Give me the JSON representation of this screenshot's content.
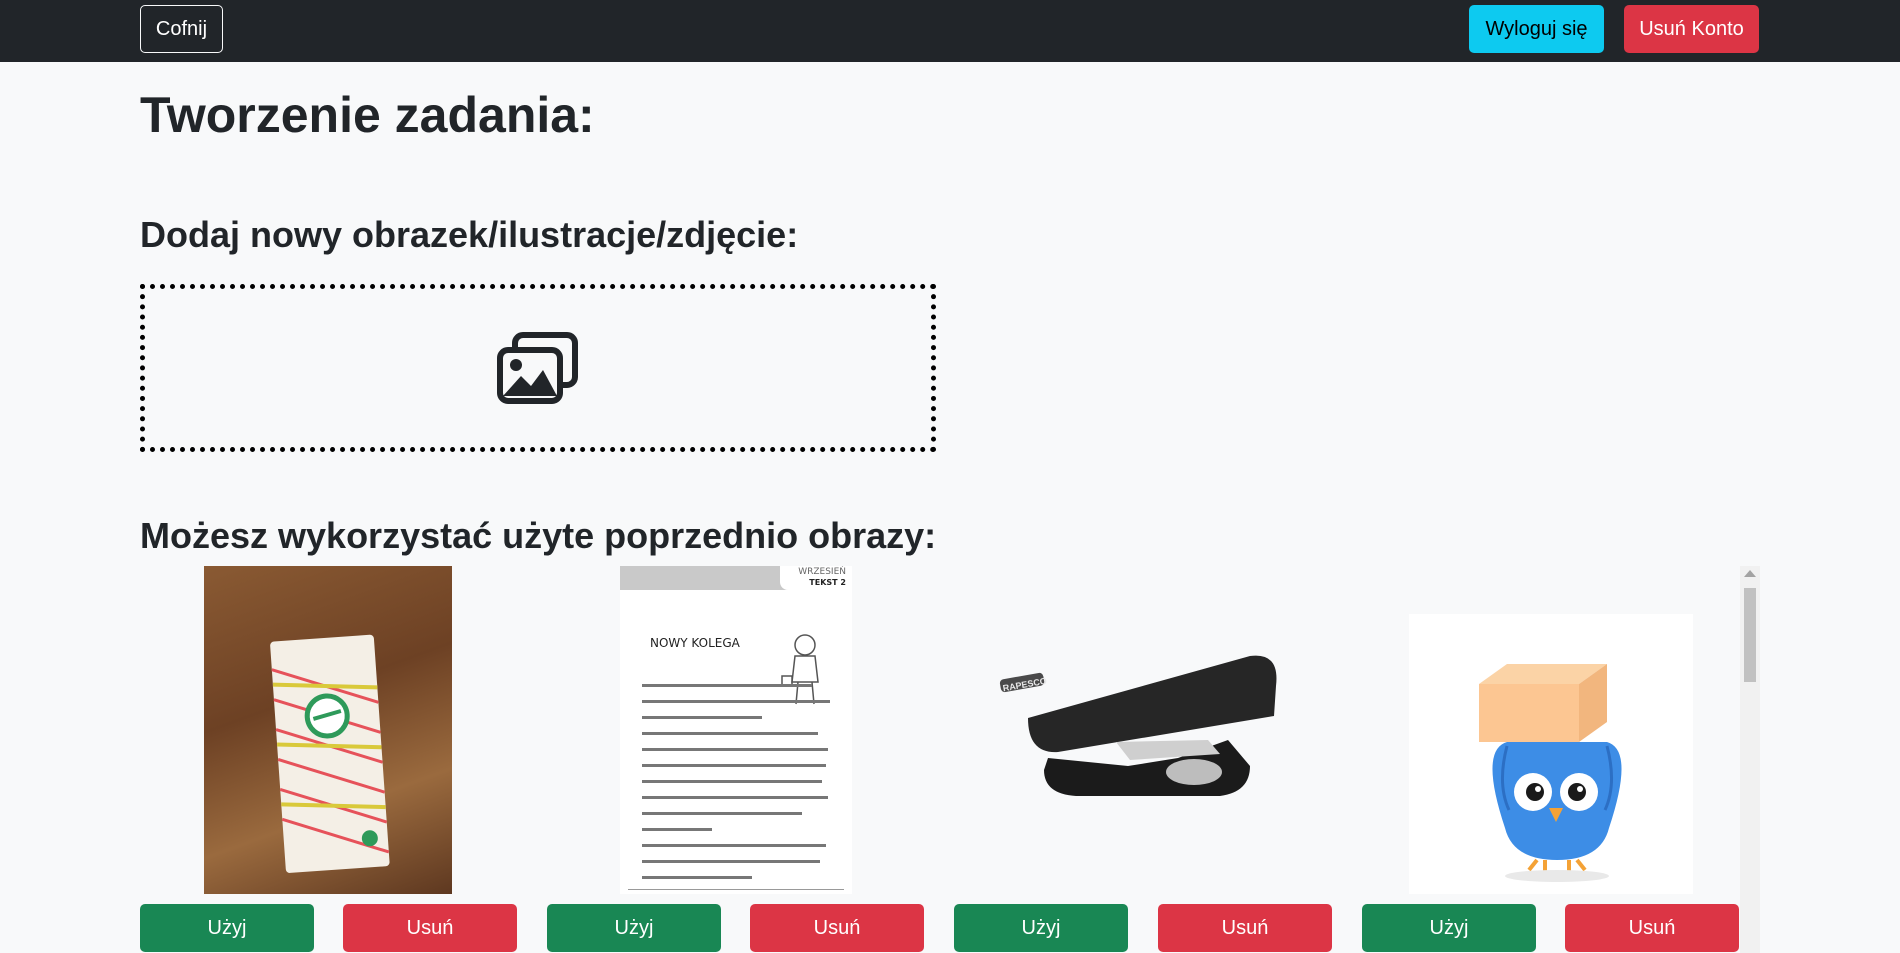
{
  "navbar": {
    "back_label": "Cofnij",
    "logout_label": "Wyloguj się",
    "delete_account_label": "Usuń Konto"
  },
  "page_title": "Tworzenie zadania:",
  "add_section": {
    "heading": "Dodaj nowy obrazek/ilustracje/zdjęcie:",
    "dropzone_icon": "images-icon"
  },
  "gallery": {
    "heading": "Możesz wykorzystać użyte poprzednio obrazy:",
    "items": [
      {
        "image": "tissue-pack-photo",
        "use_label": "Użyj",
        "delete_label": "Usuń"
      },
      {
        "image": "worksheet-page",
        "header_month": "WRZESIEŃ",
        "header_text": "TEKST 2",
        "title": "NOWY KOLEGA",
        "use_label": "Użyj",
        "delete_label": "Usuń"
      },
      {
        "image": "stapler-photo",
        "brand": "RAPESCO",
        "use_label": "Użyj",
        "delete_label": "Usuń"
      },
      {
        "image": "owl-carrying-box-illustration",
        "use_label": "Użyj",
        "delete_label": "Usuń"
      }
    ]
  },
  "colors": {
    "navbar": "#212529",
    "info": "#0dcaf0",
    "danger": "#dc3545",
    "success": "#198754",
    "background": "#f8f9fa"
  }
}
